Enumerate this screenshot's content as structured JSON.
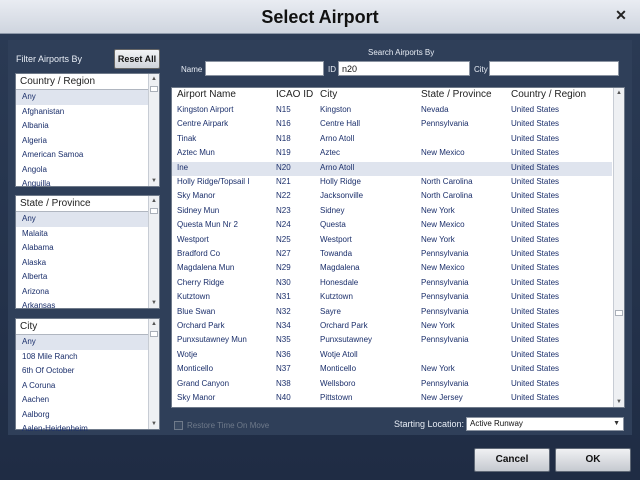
{
  "window": {
    "title": "Select Airport",
    "close_glyph": "✕"
  },
  "filter": {
    "label": "Filter Airports By",
    "reset_label": "Reset All",
    "country": {
      "header": "Country / Region",
      "items": [
        "Any",
        "Afghanistan",
        "Albania",
        "Algeria",
        "American Samoa",
        "Angola",
        "Anguilla"
      ],
      "selected": 0
    },
    "state": {
      "header": "State / Province",
      "items": [
        "Any",
        " Malaita",
        "Alabama",
        "Alaska",
        "Alberta",
        "Arizona",
        "Arkansas"
      ],
      "selected": 0
    },
    "city": {
      "header": "City",
      "items": [
        "Any",
        "108 Mile Ranch",
        "6th Of October",
        "A Coruna",
        "Aachen",
        "Aalborg",
        "Aalen-Heidenheim"
      ],
      "selected": 0
    }
  },
  "search": {
    "title": "Search Airports By",
    "name_label": "Name",
    "name_value": "",
    "id_label": "ID",
    "id_value": "n20",
    "city_label": "City",
    "city_value": ""
  },
  "grid": {
    "columns": [
      "Airport Name",
      "ICAO ID",
      "City",
      "State / Province",
      "Country / Region"
    ],
    "selected_row": 4,
    "rows": [
      [
        "Kingston Airport",
        "N15",
        "Kingston",
        "Nevada",
        "United States"
      ],
      [
        "Centre Airpark",
        "N16",
        "Centre Hall",
        "Pennsylvania",
        "United States"
      ],
      [
        "Tinak",
        "N18",
        "Arno Atoll",
        "",
        "United States"
      ],
      [
        "Aztec Mun",
        "N19",
        "Aztec",
        "New Mexico",
        "United States"
      ],
      [
        "Ine",
        "N20",
        "Arno Atoll",
        "",
        "United States"
      ],
      [
        "Holly Ridge/Topsail I",
        "N21",
        "Holly Ridge",
        "North Carolina",
        "United States"
      ],
      [
        "Sky Manor",
        "N22",
        "Jacksonville",
        "North Carolina",
        "United States"
      ],
      [
        "Sidney Mun",
        "N23",
        "Sidney",
        "New York",
        "United States"
      ],
      [
        "Questa Mun Nr 2",
        "N24",
        "Questa",
        "New Mexico",
        "United States"
      ],
      [
        "Westport",
        "N25",
        "Westport",
        "New York",
        "United States"
      ],
      [
        "Bradford Co",
        "N27",
        "Towanda",
        "Pennsylvania",
        "United States"
      ],
      [
        "Magdalena Mun",
        "N29",
        "Magdalena",
        "New Mexico",
        "United States"
      ],
      [
        "Cherry Ridge",
        "N30",
        "Honesdale",
        "Pennsylvania",
        "United States"
      ],
      [
        "Kutztown",
        "N31",
        "Kutztown",
        "Pennsylvania",
        "United States"
      ],
      [
        "Blue Swan",
        "N32",
        "Sayre",
        "Pennsylvania",
        "United States"
      ],
      [
        "Orchard Park",
        "N34",
        "Orchard Park",
        "New York",
        "United States"
      ],
      [
        "Punxsutawney Mun",
        "N35",
        "Punxsutawney",
        "Pennsylvania",
        "United States"
      ],
      [
        "Wotje",
        "N36",
        "Wotje Atoll",
        "",
        "United States"
      ],
      [
        "Monticello",
        "N37",
        "Monticello",
        "New York",
        "United States"
      ],
      [
        "Grand Canyon",
        "N38",
        "Wellsboro",
        "Pennsylvania",
        "United States"
      ],
      [
        "Sky Manor",
        "N40",
        "Pittstown",
        "New Jersey",
        "United States"
      ]
    ]
  },
  "options": {
    "checkbox_label": "Restore Time On Move",
    "start_label": "Starting Location:",
    "start_value": "Active Runway"
  },
  "buttons": {
    "cancel": "Cancel",
    "ok": "OK"
  }
}
